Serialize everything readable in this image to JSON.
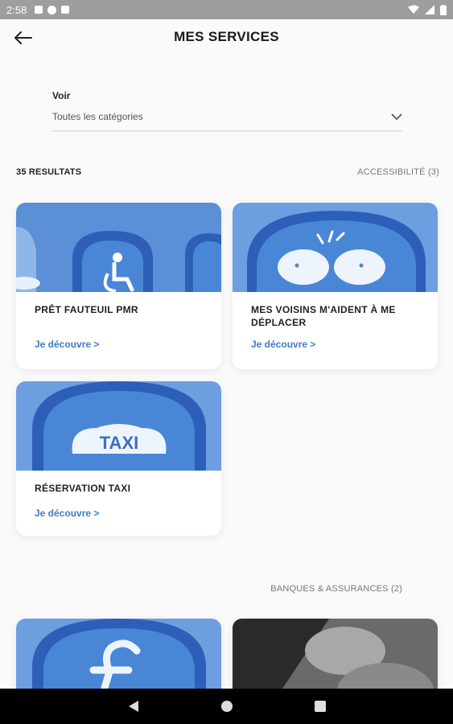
{
  "status": {
    "time": "2:58"
  },
  "header": {
    "title": "MES SERVICES"
  },
  "filter": {
    "label": "Voir",
    "value": "Toutes les catégories"
  },
  "results": {
    "count": "35 RESULTATS",
    "category_1": "ACCESSIBILITÉ (3)",
    "category_2": "BANQUES & ASSURANCES (2)"
  },
  "cards": [
    {
      "title": "PRÊT FAUTEUIL PMR",
      "link": "Je découvre >"
    },
    {
      "title": "MES VOISINS M'AIDENT À ME DÉPLACER",
      "link": "Je découvre >"
    },
    {
      "title": "RÉSERVATION TAXI",
      "link": "Je découvre >",
      "image_text": "TAXI"
    }
  ],
  "colors": {
    "accent": "#3d7dc2",
    "sky": "#4a86d6"
  }
}
